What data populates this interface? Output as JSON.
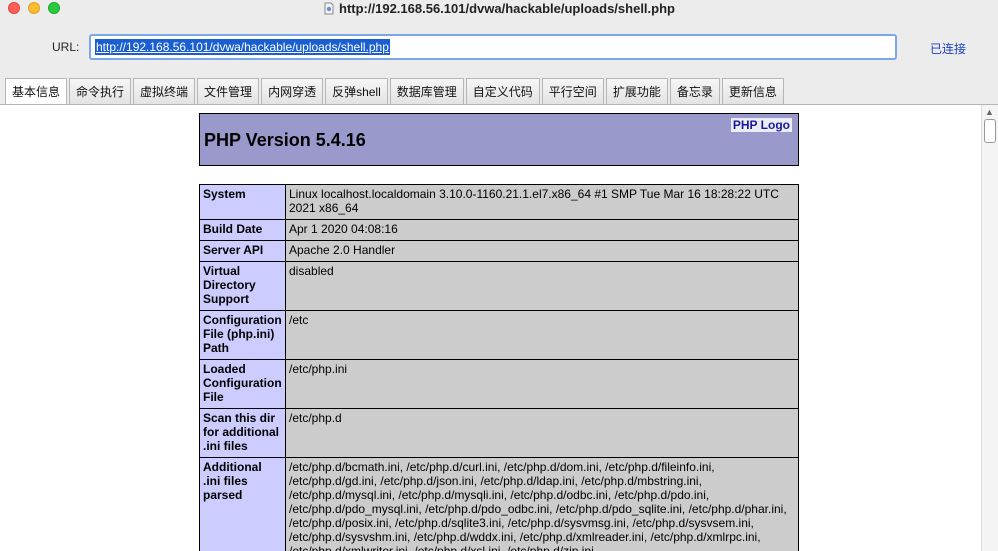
{
  "window": {
    "title": "http://192.168.56.101/dvwa/hackable/uploads/shell.php"
  },
  "url_bar": {
    "label": "URL:",
    "value": "http://192.168.56.101/dvwa/hackable/uploads/shell.php",
    "status": "已连接"
  },
  "tabs": [
    {
      "label": "基本信息",
      "active": true
    },
    {
      "label": "命令执行"
    },
    {
      "label": "虚拟终端"
    },
    {
      "label": "文件管理"
    },
    {
      "label": "内网穿透"
    },
    {
      "label": "反弹shell"
    },
    {
      "label": "数据库管理"
    },
    {
      "label": "自定义代码"
    },
    {
      "label": "平行空间"
    },
    {
      "label": "扩展功能"
    },
    {
      "label": "备忘录"
    },
    {
      "label": "更新信息"
    }
  ],
  "phpinfo": {
    "version": "PHP Version 5.4.16",
    "logo_text": "PHP Logo",
    "rows": [
      {
        "key": "System",
        "value": "Linux localhost.localdomain 3.10.0-1160.21.1.el7.x86_64 #1 SMP Tue Mar 16 18:28:22 UTC 2021 x86_64"
      },
      {
        "key": "Build Date",
        "value": "Apr 1 2020 04:08:16"
      },
      {
        "key": "Server API",
        "value": "Apache 2.0 Handler"
      },
      {
        "key": "Virtual Directory Support",
        "value": "disabled"
      },
      {
        "key": "Configuration File (php.ini) Path",
        "value": "/etc"
      },
      {
        "key": "Loaded Configuration File",
        "value": "/etc/php.ini"
      },
      {
        "key": "Scan this dir for additional .ini files",
        "value": "/etc/php.d"
      },
      {
        "key": "Additional .ini files parsed",
        "value": "/etc/php.d/bcmath.ini, /etc/php.d/curl.ini, /etc/php.d/dom.ini, /etc/php.d/fileinfo.ini, /etc/php.d/gd.ini, /etc/php.d/json.ini, /etc/php.d/ldap.ini, /etc/php.d/mbstring.ini, /etc/php.d/mysql.ini, /etc/php.d/mysqli.ini, /etc/php.d/odbc.ini, /etc/php.d/pdo.ini, /etc/php.d/pdo_mysql.ini, /etc/php.d/pdo_odbc.ini, /etc/php.d/pdo_sqlite.ini, /etc/php.d/phar.ini, /etc/php.d/posix.ini, /etc/php.d/sqlite3.ini, /etc/php.d/sysvmsg.ini, /etc/php.d/sysvsem.ini, /etc/php.d/sysvshm.ini, /etc/php.d/wddx.ini, /etc/php.d/xmlreader.ini, /etc/php.d/xmlrpc.ini, /etc/php.d/xmlwriter.ini, /etc/php.d/xsl.ini, /etc/php.d/zip.ini"
      }
    ]
  }
}
